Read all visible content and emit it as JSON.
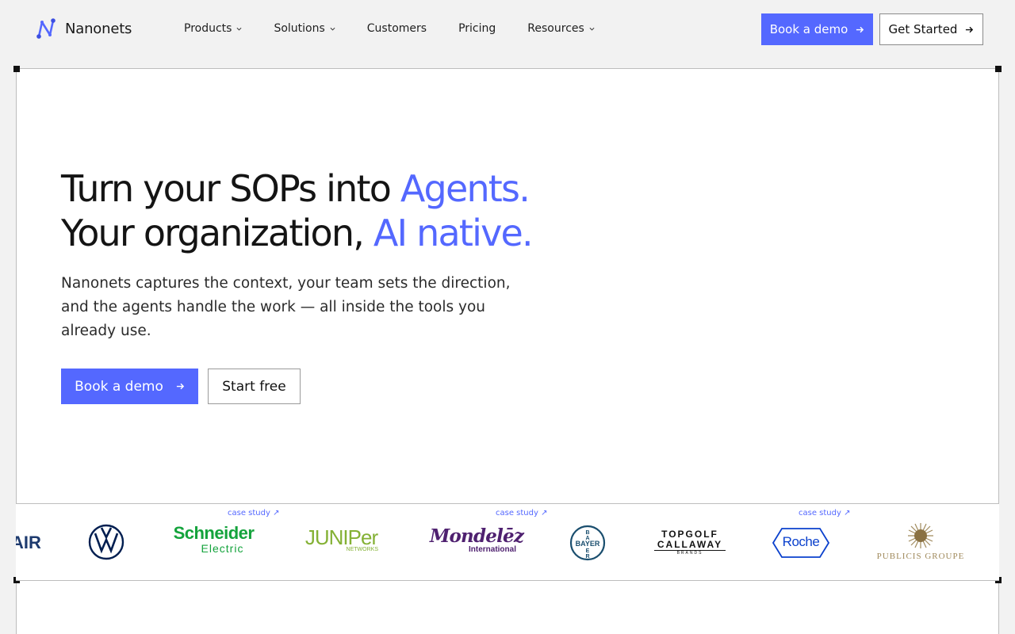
{
  "brand": {
    "name": "Nanonets"
  },
  "nav": {
    "items": [
      {
        "label": "Products",
        "dropdown": true
      },
      {
        "label": "Solutions",
        "dropdown": true
      },
      {
        "label": "Customers",
        "dropdown": false
      },
      {
        "label": "Pricing",
        "dropdown": false
      },
      {
        "label": "Resources",
        "dropdown": true
      }
    ],
    "book_demo": "Book a demo",
    "get_started": "Get Started"
  },
  "hero": {
    "title_line1": "Turn your SOPs into ",
    "title_line1_accent": "Agents.",
    "title_line2": "Your organization, ",
    "title_line2_accent": "AI native.",
    "subtitle": "Nanonets captures the context, your team sets the direction, and the agents handle the work — all inside the tools you already use.",
    "primary_cta": "Book a demo",
    "secondary_cta": "Start free"
  },
  "logos": {
    "case_study_label": "case study ↗",
    "brands": [
      {
        "name": "AIR",
        "text": "AIR",
        "color": "#1d3a6e"
      },
      {
        "name": "Volkswagen",
        "text": "",
        "color": "#001e50"
      },
      {
        "name": "Schneider Electric",
        "text": "Schneider",
        "text2": "Electric",
        "color": "#14a33c",
        "case_study": true
      },
      {
        "name": "Juniper Networks",
        "text": "JUNIPer",
        "text2": "NETWORKS",
        "color": "#84b135"
      },
      {
        "name": "Mondelēz International",
        "text": "Mondelēz",
        "text2": "International",
        "color": "#4f2170",
        "case_study": true
      },
      {
        "name": "Bayer",
        "text": "BAYER",
        "color": "#1a4e6e"
      },
      {
        "name": "Topgolf Callaway",
        "text": "TOPGOLF",
        "text2": "CALLAWAY",
        "text3": "BRANDS",
        "color": "#111111"
      },
      {
        "name": "Roche",
        "text": "Roche",
        "color": "#0b41cd",
        "case_study": true
      },
      {
        "name": "Publicis Groupe",
        "text": "PUBLICIS GROUPE",
        "color": "#a08a5c"
      }
    ]
  },
  "colors": {
    "accent": "#5468ff",
    "background": "#f2f2f2"
  }
}
